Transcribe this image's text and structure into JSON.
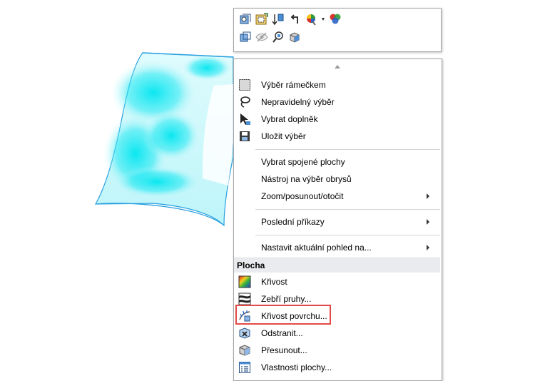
{
  "toolbar": {
    "row1_icons": [
      "zoom-to-fit-icon",
      "zoom-to-area-icon",
      "section-view-icon",
      "previous-view-icon",
      "appearance-icon",
      "scene-icon"
    ],
    "row2_icons": [
      "view-orientation-icon",
      "hide-show-icon",
      "zoom-to-selection-icon",
      "display-style-icon"
    ]
  },
  "menu": {
    "group1": [
      {
        "label": "Výběr rámečkem",
        "icon": "box-select-icon"
      },
      {
        "label": "Nepravidelný výběr",
        "icon": "lasso-select-icon"
      },
      {
        "label": "Vybrat doplněk",
        "icon": "select-other-icon"
      },
      {
        "label": "Uložit výběr",
        "icon": "save-selection-icon"
      }
    ],
    "group2": [
      {
        "label": "Vybrat spojené plochy"
      },
      {
        "label": "Nástroj na výběr obrysů"
      },
      {
        "label": "Zoom/posunout/otočit",
        "submenu": true
      }
    ],
    "group3": [
      {
        "label": "Poslední příkazy",
        "submenu": true
      }
    ],
    "group4": [
      {
        "label": "Nastavit aktuální pohled na...",
        "submenu": true
      }
    ],
    "section_title": "Plocha",
    "section_items": [
      {
        "label": "Křivost",
        "icon": "curvature-icon"
      },
      {
        "label": "Zebří pruhy...",
        "icon": "zebra-stripes-icon"
      },
      {
        "label": "Křivost povrchu...",
        "icon": "surface-curvature-icon",
        "highlighted": true
      },
      {
        "label": "Odstranit...",
        "icon": "delete-face-icon"
      },
      {
        "label": "Přesunout...",
        "icon": "move-face-icon"
      },
      {
        "label": "Vlastnosti plochy...",
        "icon": "face-properties-icon"
      }
    ]
  },
  "colors": {
    "surface_highlight": "#00e6f0",
    "surface_edge": "#2aa0e0",
    "highlight_box": "#e34a47",
    "section_header_bg": "#e9ebee"
  }
}
